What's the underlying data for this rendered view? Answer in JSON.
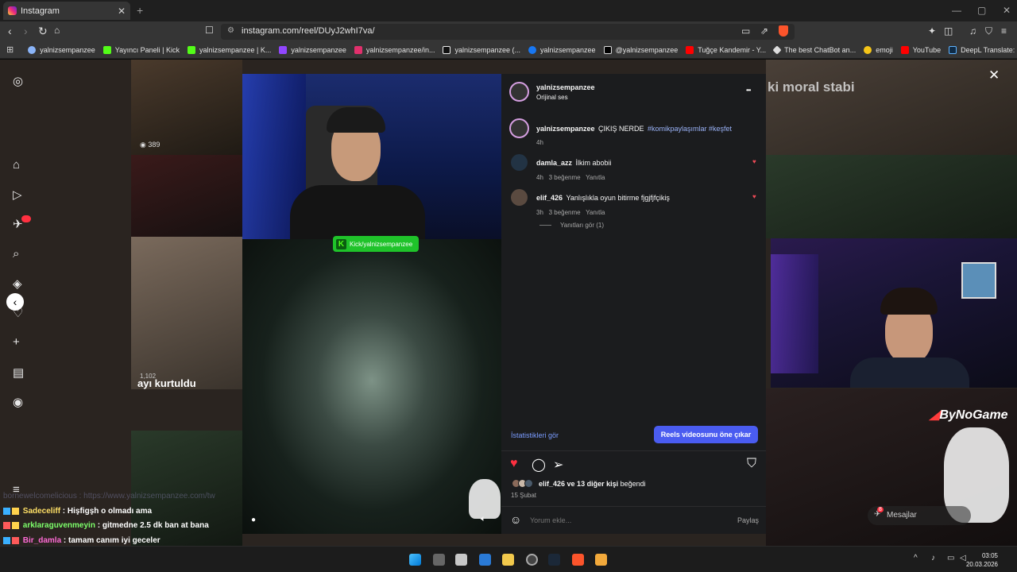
{
  "browser": {
    "tab_title": "Instagram",
    "url": "instagram.com/reel/DUyJ2whI7va/",
    "new_tab_glyph": "+",
    "tab_close_glyph": "✕",
    "window_min_glyph": "—",
    "window_max_glyph": "▢",
    "window_close_glyph": "✕",
    "bookmarks": [
      {
        "label": "yalnizsempanzee",
        "icon": "chrome-icon",
        "color": "#8ab4f8"
      },
      {
        "label": "Yayıncı Paneli | Kick",
        "icon": "kick-icon",
        "color": "#53fc18"
      },
      {
        "label": "yalnizsempanzee | K...",
        "icon": "kick-icon",
        "color": "#53fc18"
      },
      {
        "label": "yalnizsempanzee",
        "icon": "twitch-icon",
        "color": "#9146ff"
      },
      {
        "label": "yalnizsempanzee/in...",
        "icon": "instagram-icon",
        "color": "#e1306c"
      },
      {
        "label": "yalnizsempanzee (...",
        "icon": "tiktok-icon",
        "color": "#ffffff"
      },
      {
        "label": "yalnizsempanzee",
        "icon": "facebook-icon",
        "color": "#1877f2"
      },
      {
        "label": "@yalnizsempanzee",
        "icon": "x-icon",
        "color": "#ffffff"
      },
      {
        "label": "Tuğçe Kandemir - Y...",
        "icon": "youtube-icon",
        "color": "#ff0000"
      },
      {
        "label": "The best ChatBot an...",
        "icon": "chatbot-icon",
        "color": "#dddddd"
      },
      {
        "label": "emoji",
        "icon": "emoji-icon",
        "color": "#f5c518"
      },
      {
        "label": "YouTube",
        "icon": "youtube-icon",
        "color": "#ff0000"
      },
      {
        "label": "DeepL Translate: Dü...",
        "icon": "deepl-icon",
        "color": "#0f2b46"
      }
    ],
    "more_bookmarks_glyph": "»"
  },
  "background": {
    "view_count": "389",
    "tile_caption": "ayı kurtuldu",
    "tile_views": "1,102",
    "top_overlay_text": "ki moral stabi",
    "watermark": "ByNoGame",
    "messages_label": "Mesajlar",
    "messages_count": "8"
  },
  "video": {
    "kick_badge": "Kick/yalnizsempanzee",
    "kick_letter": "K"
  },
  "post": {
    "author": "yalnizsempanzee",
    "audio": "Orijinal ses",
    "more_glyph": "•••",
    "caption_user": "yalnizsempanzee",
    "caption_text": "ÇIKIŞ NERDE",
    "caption_tags": "#komikpaylaşımlar #keşfet",
    "caption_time": "4h",
    "comments": [
      {
        "user": "damla_azz",
        "text": "İlkim abobii",
        "time": "4h",
        "likes": "3 beğenme",
        "reply": "Yanıtla"
      },
      {
        "user": "elif_426",
        "text": "Yanlışlıkla oyun bitirme fjgjfjfçikiş",
        "time": "3h",
        "likes": "3 beğenme",
        "reply": "Yanıtla"
      }
    ],
    "view_replies": "Yanıtları gör (1)",
    "stats_link": "İstatistikleri gör",
    "promote_button": "Reels videosunu öne çıkar",
    "liked_by_user": "elif_426",
    "liked_by_rest": "ve 13 diğer kişi",
    "liked_by_suffix": "beğendi",
    "date": "15 Şubat",
    "comment_placeholder": "Yorum ekle...",
    "share_button": "Paylaş",
    "close_glyph": "✕"
  },
  "chat": [
    {
      "user": "Sadeceliff",
      "text": "Hişfigşh o olmadı ama",
      "color": "#ffe066"
    },
    {
      "user": "arklaraguvenmeyin",
      "text": "gitmedne 2.5 dk ban at bana",
      "color": "#7dff6b"
    },
    {
      "user": "Bir_damla",
      "text": "tamam canım iyi geceler",
      "color": "#ff6bd6"
    }
  ],
  "chat_separator": " : ",
  "chat_blurred_line": "bornewelcomelicious : https://www.yalnizsempanzee.com/tw",
  "taskbar": {
    "time": "03:05",
    "date": "20.03.2026"
  }
}
